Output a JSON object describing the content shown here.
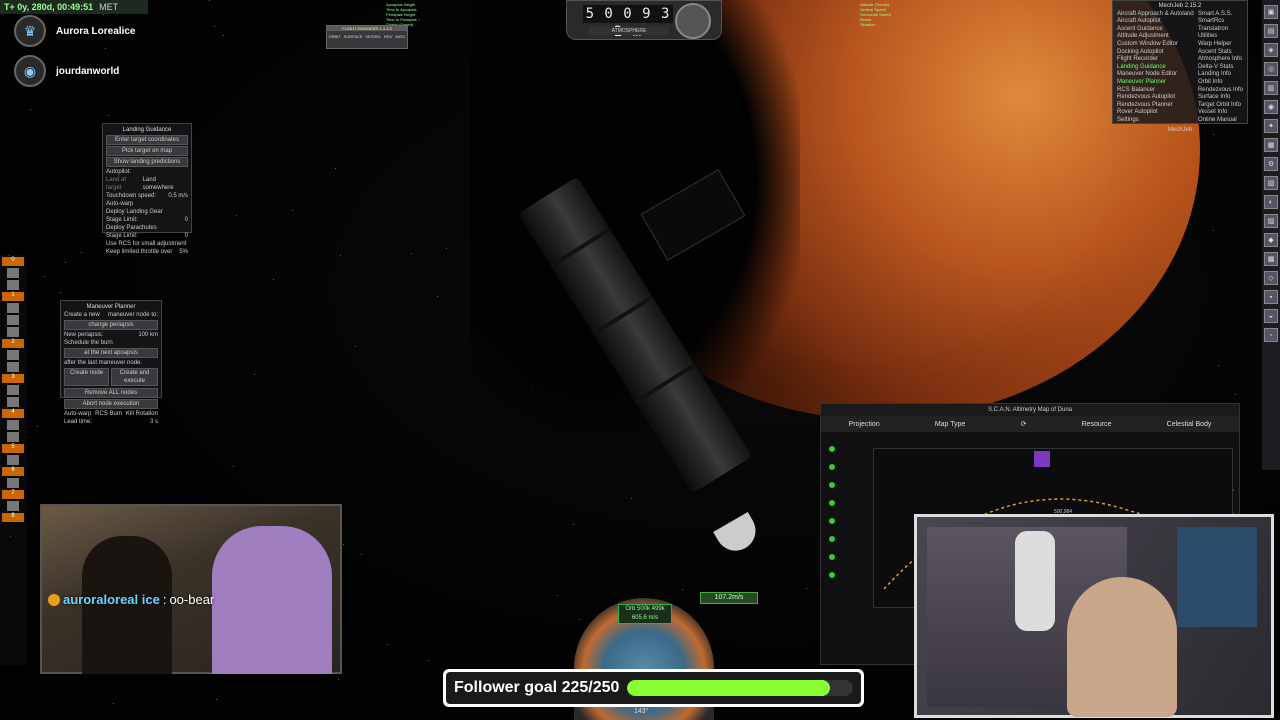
{
  "ksp_header": {
    "met_time": "T+ 0y, 280d, 00:49:51",
    "met_label": "MET"
  },
  "socials": [
    {
      "icon": "trophy-icon",
      "name": "Aurora Lorealice"
    },
    {
      "icon": "twitch-icon",
      "name": "jourdanworld"
    }
  ],
  "orbit_info_left": [
    "Apoapsis Height",
    "Time to Apoapsis",
    "Periapsis Height",
    "Time to Periapsis",
    "Orbital (Speed)"
  ],
  "orbit_info_right": [
    "Altitude (Terrain)",
    "Vertical Speed",
    "Horizontal Speed",
    "Biome",
    "Situation"
  ],
  "flight_engineer": {
    "title": "FLIGHT ENGINEER 1.1.3.3",
    "buttons": [
      "ORBIT",
      "SURFACE",
      "VESSEL",
      "RDV",
      "MISC"
    ]
  },
  "odometer": {
    "value": "5 0 0 9 3 2 m",
    "label": "ATMOSPHERE"
  },
  "landing_guidance": {
    "title": "Landing Guidance",
    "enter_coords": "Enter target coordinates",
    "pick_target": "Pick target on map",
    "show_predictions": "Show landing predictions",
    "autopilot_label": "Autopilot:",
    "land_at_target": "Land at target",
    "land_somewhere": "Land somewhere",
    "touchdown_label": "Touchdown speed:",
    "touchdown_value": "0.5",
    "touchdown_unit": "m/s",
    "options": [
      "Auto-warp",
      "Deploy Landing Gear",
      "Stage Limit:",
      "Deploy Parachutes",
      "Stage Limit:",
      "Use RCS for small adjustment",
      "Keep limited throttle over"
    ],
    "stage_limit_value": "0",
    "throttle_value": "5",
    "throttle_unit": "%"
  },
  "maneuver_planner": {
    "title": "Maneuver Planner",
    "create_new": "Create a new",
    "node_to": "maneuver node to:",
    "operation": "change periapsis",
    "new_periapsis_label": "New periapsis:",
    "new_periapsis_value": "100",
    "unit": "km",
    "schedule": "Schedule the burn",
    "timing": "at the next apoapsis",
    "after": "after the last maneuver node.",
    "create_node": "Create node",
    "create_execute": "Create and execute",
    "remove_all": "Remove ALL nodes",
    "abort": "Abort node execution",
    "autowarp": "Auto-warp",
    "rcs_burn": "RCS Burn",
    "kill_rotation": "Kill Rotation",
    "lead_time_label": "Lead time:",
    "lead_time_value": "3",
    "lead_time_unit": "s"
  },
  "mechjeb": {
    "title": "MechJeb 2.15.2",
    "left": [
      "Aircraft Approach & Autoland",
      "Aircraft Autopilot",
      "Ascent Guidance",
      "Attitude Adjustment",
      "Custom Window Editor",
      "Docking Autopilot",
      "Flight Recorder",
      "Landing Guidance",
      "Maneuver Node Editor",
      "Maneuver Planner",
      "RCS Balancer",
      "Rendezvous Autopilot",
      "Rendezvous Planner",
      "Rover Autopilot",
      "Settings"
    ],
    "right": [
      "Smart A.S.S.",
      "SmartRcs",
      "Translatron",
      "Utilities",
      "Warp Helper",
      "Ascent Stats",
      "Atmosphere Info",
      "Delta-V Stats",
      "Landing Info",
      "Orbit Info",
      "Rendezvous Info",
      "Surface Info",
      "Target Orbit Info",
      "Vessel Info",
      "Online Manual"
    ],
    "active_left": [
      "Landing Guidance",
      "Maneuver Planner"
    ],
    "footer": "MechJeb"
  },
  "scansat": {
    "title": "S.C.A.N. Altimetry Map of Duna",
    "tabs": [
      "Projection",
      "Map Type",
      "Resource",
      "Celestial Body"
    ],
    "readout": "500,984"
  },
  "chat": {
    "user": "auroraloreal ice",
    "message": "oo-bear"
  },
  "follower_goal": {
    "label": "Follower goal 225/250",
    "current": 225,
    "target": 250
  },
  "navball": {
    "orbit_label": "Orb 500k 499k",
    "speed": "605.6 m/s",
    "heading": "143°"
  },
  "surface_speed": "107.2m/s",
  "stage_numbers": [
    "0",
    "1",
    "2",
    "3",
    "4",
    "5",
    "6",
    "7",
    "8"
  ],
  "colors": {
    "accent_green": "#88ff33",
    "panel": "#19191c",
    "chat_user": "#6bd4ff"
  }
}
